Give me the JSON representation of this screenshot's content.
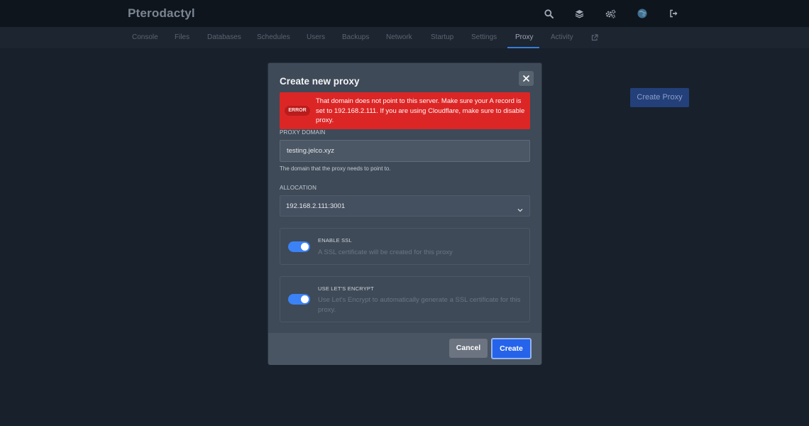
{
  "header": {
    "brand": "Pterodactyl",
    "icons": [
      "search-icon",
      "layers-icon",
      "cogs-icon",
      "avatar",
      "sign-out-icon"
    ]
  },
  "nav": {
    "items": [
      {
        "label": "Console"
      },
      {
        "label": "Files"
      },
      {
        "label": "Databases"
      },
      {
        "label": "Schedules"
      },
      {
        "label": "Users"
      },
      {
        "label": "Backups"
      },
      {
        "label": "Network"
      },
      {
        "label": "Startup"
      },
      {
        "label": "Settings"
      },
      {
        "label": "Proxy"
      },
      {
        "label": "Activity"
      }
    ],
    "active": "Proxy",
    "external_icon": "external-link-icon"
  },
  "page": {
    "create_proxy_label": "Create Proxy"
  },
  "modal": {
    "title": "Create new proxy",
    "error": {
      "badge": "ERROR",
      "message": "That domain does not point to this server. Make sure your A record is set to 192.168.2.111. If you are using Cloudflare, make sure to disable proxy."
    },
    "domain": {
      "label": "PROXY DOMAIN",
      "value": "testing.jelco.xyz",
      "helper": "The domain that the proxy needs to point to."
    },
    "allocation": {
      "label": "ALLOCATION",
      "value": "192.168.2.111:3001"
    },
    "ssl": {
      "title": "ENABLE SSL",
      "description": "A SSL certificate will be created for this proxy",
      "enabled": true
    },
    "letsencrypt": {
      "title": "USE LET'S ENCRYPT",
      "description": "Use Let's Encrypt to automatically generate a SSL certificate for this proxy.",
      "enabled": true
    },
    "cancel_label": "Cancel",
    "create_label": "Create"
  },
  "colors": {
    "accent": "#3b82f6",
    "error": "#dc2626",
    "background": "#18202b"
  }
}
